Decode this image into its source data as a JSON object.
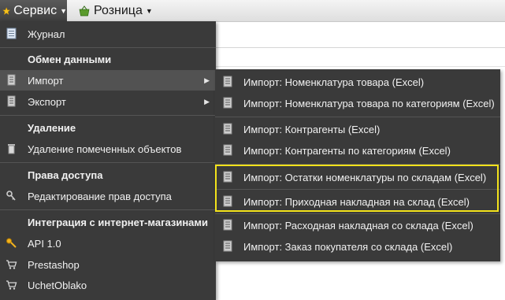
{
  "topbar": {
    "service_label": "Сервис",
    "retail_label": "Розница",
    "service_icon": "star-icon",
    "retail_icon": "basket-icon"
  },
  "dropdown": {
    "journal": "Журнал",
    "exchange_header": "Обмен данными",
    "import": "Импорт",
    "export": "Экспорт",
    "delete_header": "Удаление",
    "delete_marked": "Удаление помеченных объектов",
    "access_header": "Права доступа",
    "edit_access": "Редактирование прав доступа",
    "integration_header": "Интеграция с интернет-магазинами",
    "api": "API 1.0",
    "prestashop": "Prestashop",
    "ucheto": "UchetOblako"
  },
  "submenu": {
    "items": [
      "Импорт: Номенклатура товара (Excel)",
      "Импорт: Номенклатура товара по категориям (Excel)",
      "Импорт: Контрагенты (Excel)",
      "Импорт: Контрагенты по категориям (Excel)",
      "Импорт: Остатки номенклатуры по складам (Excel)",
      "Импорт: Приходная накладная на склад (Excel)",
      "Импорт: Расходная накладная со склада (Excel)",
      "Импорт: Заказ покупателя со склада (Excel)"
    ]
  },
  "colors": {
    "menu_bg": "#3a3a3a",
    "highlight_border": "#f2e21b",
    "active_row": "#525252"
  }
}
